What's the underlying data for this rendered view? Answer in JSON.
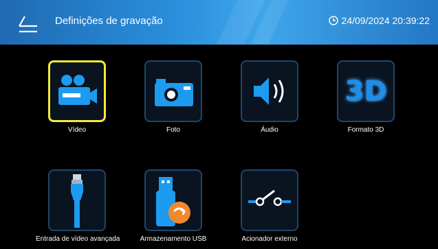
{
  "header": {
    "title": "Definições de gravação",
    "datetime": "24/09/2024 20:39:22",
    "back_icon": "back-arrow-icon",
    "clock_icon": "clock-icon"
  },
  "menu": {
    "items": [
      {
        "label": "Vídeo",
        "icon": "video-camera-icon",
        "selected": true
      },
      {
        "label": "Foto",
        "icon": "camera-icon",
        "selected": false
      },
      {
        "label": "Áudio",
        "icon": "speaker-icon",
        "selected": false
      },
      {
        "label": "Formato 3D",
        "icon": "3d-icon",
        "icon_text": "3D",
        "selected": false
      },
      {
        "label": "Entrada de vídeo avançada",
        "icon": "cable-icon",
        "selected": false
      },
      {
        "label": "Armazenamento USB",
        "icon": "usb-storage-icon",
        "selected": false
      },
      {
        "label": "Acionador externo",
        "icon": "trigger-switch-icon",
        "selected": false
      }
    ]
  },
  "colors": {
    "accent": "#2a8fdc",
    "icon_blue": "#1d9bf0",
    "selection": "#f2ea3a",
    "tile_border": "#20476a"
  }
}
